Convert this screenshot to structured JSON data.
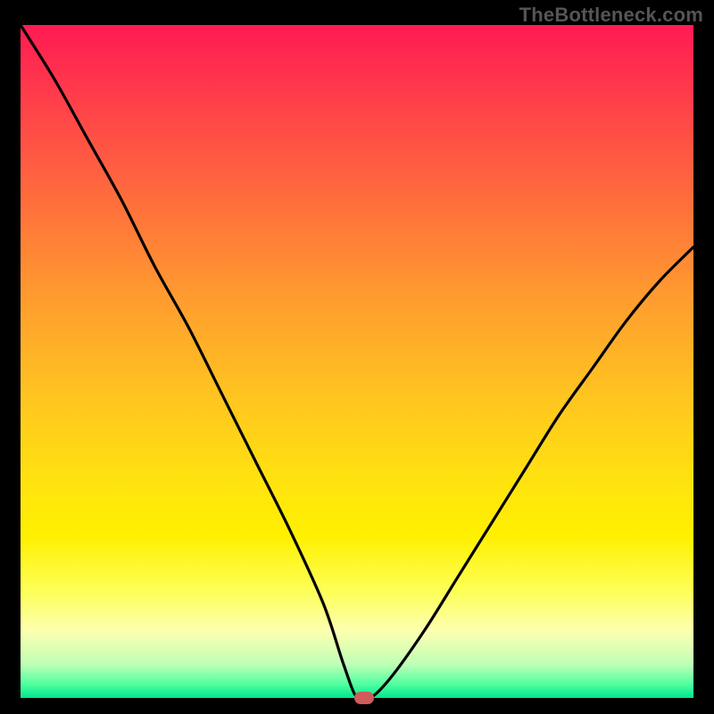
{
  "watermark": "TheBottleneck.com",
  "chart_data": {
    "type": "line",
    "title": "",
    "xlabel": "",
    "ylabel": "",
    "xlim": [
      0,
      100
    ],
    "ylim": [
      0,
      100
    ],
    "x": [
      0,
      5,
      10,
      15,
      20,
      25,
      30,
      35,
      40,
      45,
      48,
      50,
      52,
      55,
      60,
      65,
      70,
      75,
      80,
      85,
      90,
      95,
      100
    ],
    "values": [
      100,
      92,
      83,
      74,
      64,
      55,
      45,
      35,
      25,
      14,
      5,
      0,
      0,
      3,
      10,
      18,
      26,
      34,
      42,
      49,
      56,
      62,
      67
    ],
    "marker": {
      "x": 51,
      "y": 0
    },
    "gradient_stops": [
      {
        "pos": 0,
        "color": "#ff1a52"
      },
      {
        "pos": 25,
        "color": "#ff6a3d"
      },
      {
        "pos": 55,
        "color": "#ffc420"
      },
      {
        "pos": 76,
        "color": "#fff000"
      },
      {
        "pos": 90,
        "color": "#fdffb0"
      },
      {
        "pos": 100,
        "color": "#00e68f"
      }
    ]
  }
}
